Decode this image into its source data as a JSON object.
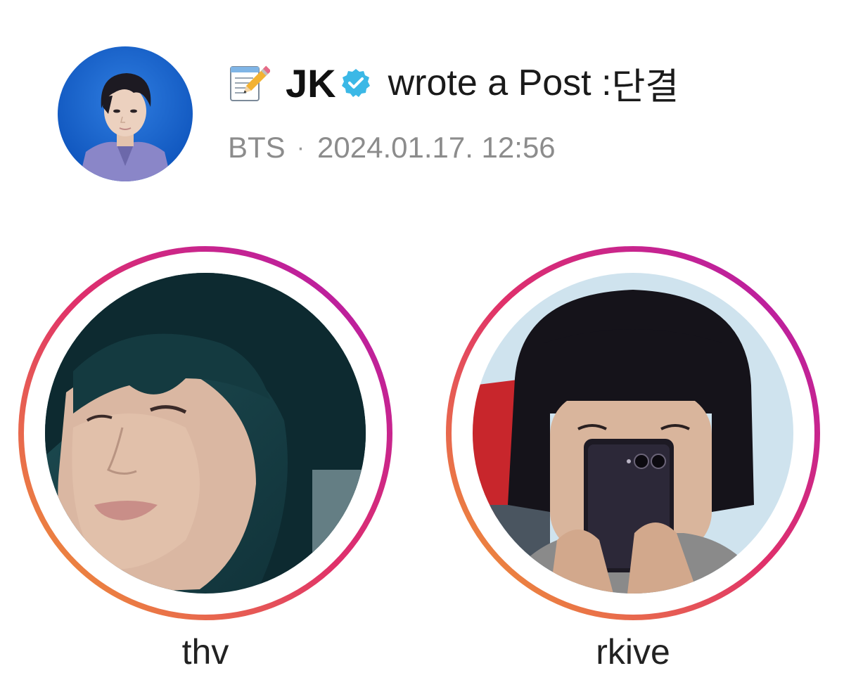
{
  "post": {
    "author": "JK",
    "action": "wrote a Post : ",
    "title": "단결",
    "group": "BTS",
    "separator": "·",
    "timestamp": "2024.01.17. 12:56",
    "icons": {
      "memo": "memo-pencil-icon",
      "verified": "verified-check-icon"
    }
  },
  "stories": [
    {
      "username": "thv"
    },
    {
      "username": "rkive"
    }
  ],
  "colors": {
    "verified_badge": "#3bb8e6",
    "ring_start": "#f0a030",
    "ring_mid": "#e0306a",
    "ring_end": "#b01ab0",
    "meta_text": "#8c8c8c"
  }
}
